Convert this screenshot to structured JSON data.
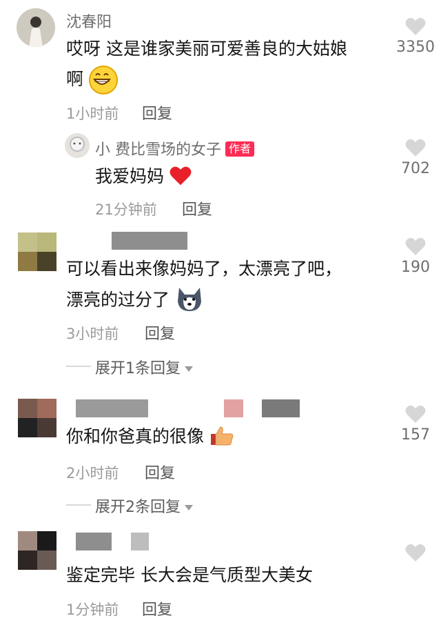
{
  "comments": [
    {
      "username": "沈春阳",
      "text_line1": "哎呀 这是谁家美丽可爱善良的大姑娘",
      "text_line2": "啊",
      "time": "1小时前",
      "reply_label": "回复",
      "likes": "3350",
      "emoji": "grinning-face"
    },
    {
      "username": "小 费比雪场的女子",
      "author_badge": "作者",
      "text": "我爱妈妈",
      "emoji": "red-heart",
      "time": "21分钟前",
      "reply_label": "回复",
      "likes": "702"
    },
    {
      "text_line1": "可以看出来像妈妈了，太漂亮了吧，",
      "text_line2": "漂亮的过分了",
      "emoji": "husky-dog",
      "time": "3小时前",
      "reply_label": "回复",
      "likes": "190",
      "expand_label": "展开1条回复"
    },
    {
      "text": "你和你爸真的很像",
      "emoji": "thumbs-up",
      "time": "2小时前",
      "reply_label": "回复",
      "likes": "157",
      "expand_label": "展开2条回复"
    },
    {
      "text": "鉴定完毕 长大会是气质型大美女",
      "time": "1分钟前",
      "reply_label": "回复"
    }
  ],
  "colors": {
    "author_badge": "#fe2c55",
    "heart_icon": "#d6d6d6",
    "meta_text": "#9a9a9a"
  }
}
